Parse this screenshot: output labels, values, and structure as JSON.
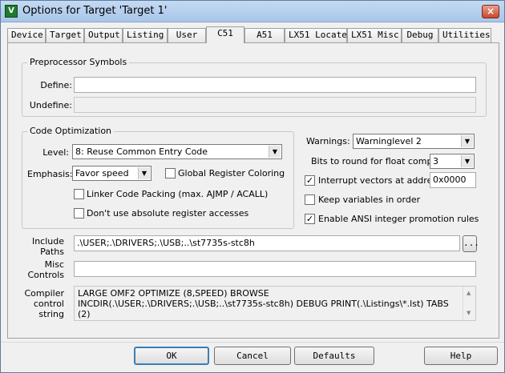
{
  "window": {
    "title": "Options for Target 'Target 1'",
    "app_icon": "uvision-icon",
    "close_label": "×"
  },
  "tabs": [
    {
      "label": "Device"
    },
    {
      "label": "Target"
    },
    {
      "label": "Output"
    },
    {
      "label": "Listing"
    },
    {
      "label": "User"
    },
    {
      "label": "C51"
    },
    {
      "label": "A51"
    },
    {
      "label": "LX51 Locate"
    },
    {
      "label": "LX51 Misc"
    },
    {
      "label": "Debug"
    },
    {
      "label": "Utilities"
    }
  ],
  "active_tab": "C51",
  "preprocessor": {
    "title": "Preprocessor Symbols",
    "define_label": "Define:",
    "define_value": "",
    "undefine_label": "Undefine:",
    "undefine_value": ""
  },
  "code_opt": {
    "title": "Code Optimization",
    "level_label": "Level:",
    "level_value": "8: Reuse Common Entry Code",
    "emphasis_label": "Emphasis:",
    "emphasis_value": "Favor speed",
    "global_reg_label": "Global Register Coloring",
    "global_reg_checked": false,
    "linker_pack_label": "Linker Code Packing (max. AJMP / ACALL)",
    "linker_pack_checked": false,
    "no_abs_label": "Don't use absolute register accesses",
    "no_abs_checked": false
  },
  "right": {
    "warnings_label": "Warnings:",
    "warnings_value": "Warninglevel 2",
    "bits_label": "Bits to round for float compare:",
    "bits_value": "3",
    "interrupt_label": "Interrupt vectors at address:",
    "interrupt_checked": true,
    "interrupt_value": "0x0000",
    "keep_vars_label": "Keep variables in order",
    "keep_vars_checked": false,
    "ansi_label": "Enable ANSI integer promotion rules",
    "ansi_checked": true
  },
  "paths": {
    "include_label": "Include\nPaths",
    "include_value": ".\\USER;.\\DRIVERS;.\\USB;..\\st7735s-stc8h",
    "browse_label": "...",
    "misc_label": "Misc\nControls",
    "misc_value": "",
    "compiler_label": "Compiler\ncontrol\nstring",
    "compiler_value": "LARGE OMF2 OPTIMIZE (8,SPEED) BROWSE INCDIR(.\\USER;.\\DRIVERS;.\\USB;..\\st7735s-stc8h) DEBUG PRINT(.\\Listings\\*.lst) TABS (2)"
  },
  "buttons": {
    "ok": "OK",
    "cancel": "Cancel",
    "defaults": "Defaults",
    "help": "Help"
  }
}
